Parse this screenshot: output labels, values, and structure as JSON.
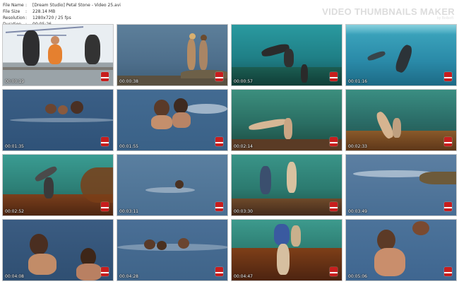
{
  "info": {
    "rows": [
      {
        "key": "File Name",
        "value": "[Dream Studio] Petal Stone - Video 25.avi"
      },
      {
        "key": "File Size",
        "value": "228.14 MB"
      },
      {
        "key": "Resolution",
        "value": "1280x720 / 25 fps"
      },
      {
        "key": "Duration",
        "value": "00:05:26"
      }
    ]
  },
  "brand": {
    "name": "VIDEO THUMBNAILS MAKER",
    "sub": "by Boilsoft"
  },
  "thumbs": [
    {
      "time": "00:00:19"
    },
    {
      "time": "00:00:38"
    },
    {
      "time": "00:00:57"
    },
    {
      "time": "00:01:16"
    },
    {
      "time": "00:01:35"
    },
    {
      "time": "00:01:55"
    },
    {
      "time": "00:02:14"
    },
    {
      "time": "00:02:33"
    },
    {
      "time": "00:02:52"
    },
    {
      "time": "00:03:11"
    },
    {
      "time": "00:03:30"
    },
    {
      "time": "00:03:49"
    },
    {
      "time": "00:04:08"
    },
    {
      "time": "00:04:28"
    },
    {
      "time": "00:04:47"
    },
    {
      "time": "00:05:06"
    }
  ]
}
